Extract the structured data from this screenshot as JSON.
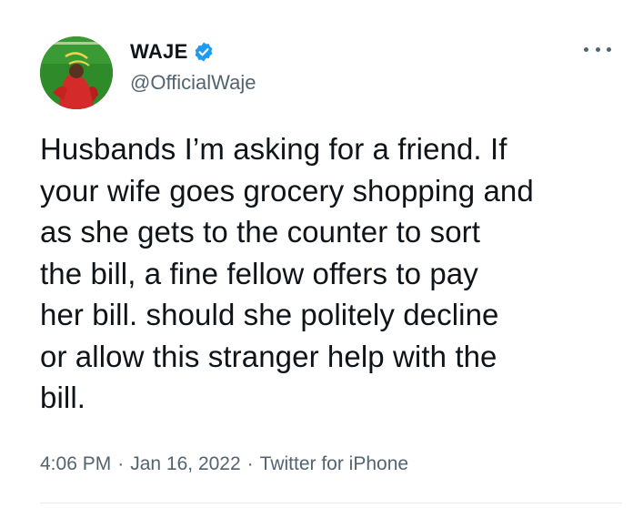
{
  "tweet": {
    "display_name": "WAJE",
    "handle": "@OfficialWaje",
    "text": "Husbands I’m asking for a friend. If\nyour wife goes grocery shopping and\nas she gets to the counter to sort\nthe bill, a fine fellow offers to pay\nher bill. should she politely decline\nor allow this stranger help with the\nbill.",
    "time": "4:06 PM",
    "date": "Jan 16, 2022",
    "source": "Twitter for iPhone",
    "separator": "·"
  },
  "icons": {
    "verified": "verified-badge-icon",
    "more": "more-options-icon"
  },
  "colors": {
    "text_primary": "#0f1419",
    "text_secondary": "#536471",
    "verified_blue": "#1d9bf0",
    "avatar_bg": "#2f8a2a"
  }
}
